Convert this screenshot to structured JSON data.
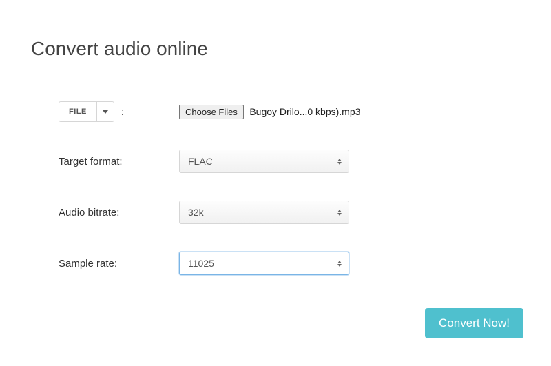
{
  "header": {
    "title": "Convert audio online"
  },
  "file_source": {
    "button_label": "FILE",
    "separator": ":",
    "choose_label": "Choose Files",
    "selected_filename": "Bugoy Drilo...0 kbps).mp3"
  },
  "target_format": {
    "label": "Target format:",
    "value": "FLAC"
  },
  "audio_bitrate": {
    "label": "Audio bitrate:",
    "value": "32k"
  },
  "sample_rate": {
    "label": "Sample rate:",
    "value": "11025"
  },
  "actions": {
    "convert_label": "Convert Now!"
  }
}
